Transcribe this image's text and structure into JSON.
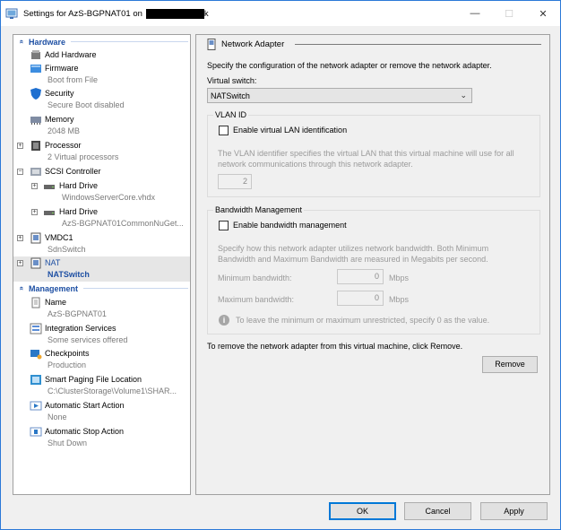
{
  "window": {
    "title_prefix": "Settings for AzS-BGPNAT01 on",
    "title_suffix": "k",
    "minimize_glyph": "—",
    "maximize_glyph": "☐",
    "close_glyph": "✕"
  },
  "tree": {
    "hardware_header": "Hardware",
    "management_header": "Management",
    "collapse_glyph": "»",
    "hardware": [
      {
        "name": "add-hardware",
        "label": "Add Hardware",
        "sub": ""
      },
      {
        "name": "firmware",
        "label": "Firmware",
        "sub": "Boot from File"
      },
      {
        "name": "security",
        "label": "Security",
        "sub": "Secure Boot disabled"
      },
      {
        "name": "memory",
        "label": "Memory",
        "sub": "2048 MB"
      },
      {
        "name": "processor",
        "label": "Processor",
        "sub": "2 Virtual processors"
      },
      {
        "name": "scsi-controller",
        "label": "SCSI Controller",
        "sub": ""
      },
      {
        "name": "hard-drive-1",
        "label": "Hard Drive",
        "sub": "WindowsServerCore.vhdx"
      },
      {
        "name": "hard-drive-2",
        "label": "Hard Drive",
        "sub": "AzS-BGPNAT01CommonNuGet..."
      },
      {
        "name": "vmdc1",
        "label": "VMDC1",
        "sub": "SdnSwitch"
      },
      {
        "name": "nat",
        "label": "NAT",
        "sub": "NATSwitch"
      }
    ],
    "management": [
      {
        "name": "vm-name",
        "label": "Name",
        "sub": "AzS-BGPNAT01"
      },
      {
        "name": "integration-services",
        "label": "Integration Services",
        "sub": "Some services offered"
      },
      {
        "name": "checkpoints",
        "label": "Checkpoints",
        "sub": "Production"
      },
      {
        "name": "smart-paging",
        "label": "Smart Paging File Location",
        "sub": "C:\\ClusterStorage\\Volume1\\SHAR..."
      },
      {
        "name": "auto-start",
        "label": "Automatic Start Action",
        "sub": "None"
      },
      {
        "name": "auto-stop",
        "label": "Automatic Stop Action",
        "sub": "Shut Down"
      }
    ]
  },
  "panel": {
    "title": "Network Adapter",
    "description": "Specify the configuration of the network adapter or remove the network adapter.",
    "virtual_switch_label": "Virtual switch:",
    "virtual_switch_value": "NATSwitch",
    "dropdown_glyph": "⌄",
    "vlan": {
      "group_label": "VLAN ID",
      "checkbox_label": "Enable virtual LAN identification",
      "help": "The VLAN identifier specifies the virtual LAN that this virtual machine will use for all",
      "help2": "network communications through this network adapter.",
      "value": "2"
    },
    "bandwidth": {
      "group_label": "Bandwidth Management",
      "checkbox_label": "Enable bandwidth management",
      "help": "Specify how this network adapter utilizes network bandwidth. Both Minimum",
      "help2": "Bandwidth and Maximum Bandwidth are measured in Megabits per second.",
      "min_label": "Minimum bandwidth:",
      "min_value": "0",
      "max_label": "Maximum bandwidth:",
      "max_value": "0",
      "unit": "Mbps",
      "info_glyph": "i",
      "info": "To leave the minimum or maximum unrestricted, specify 0 as the value."
    },
    "remove_text": "To remove the network adapter from this virtual machine, click Remove.",
    "remove_button": "Remove"
  },
  "footer": {
    "ok": "OK",
    "cancel": "Cancel",
    "apply": "Apply"
  }
}
